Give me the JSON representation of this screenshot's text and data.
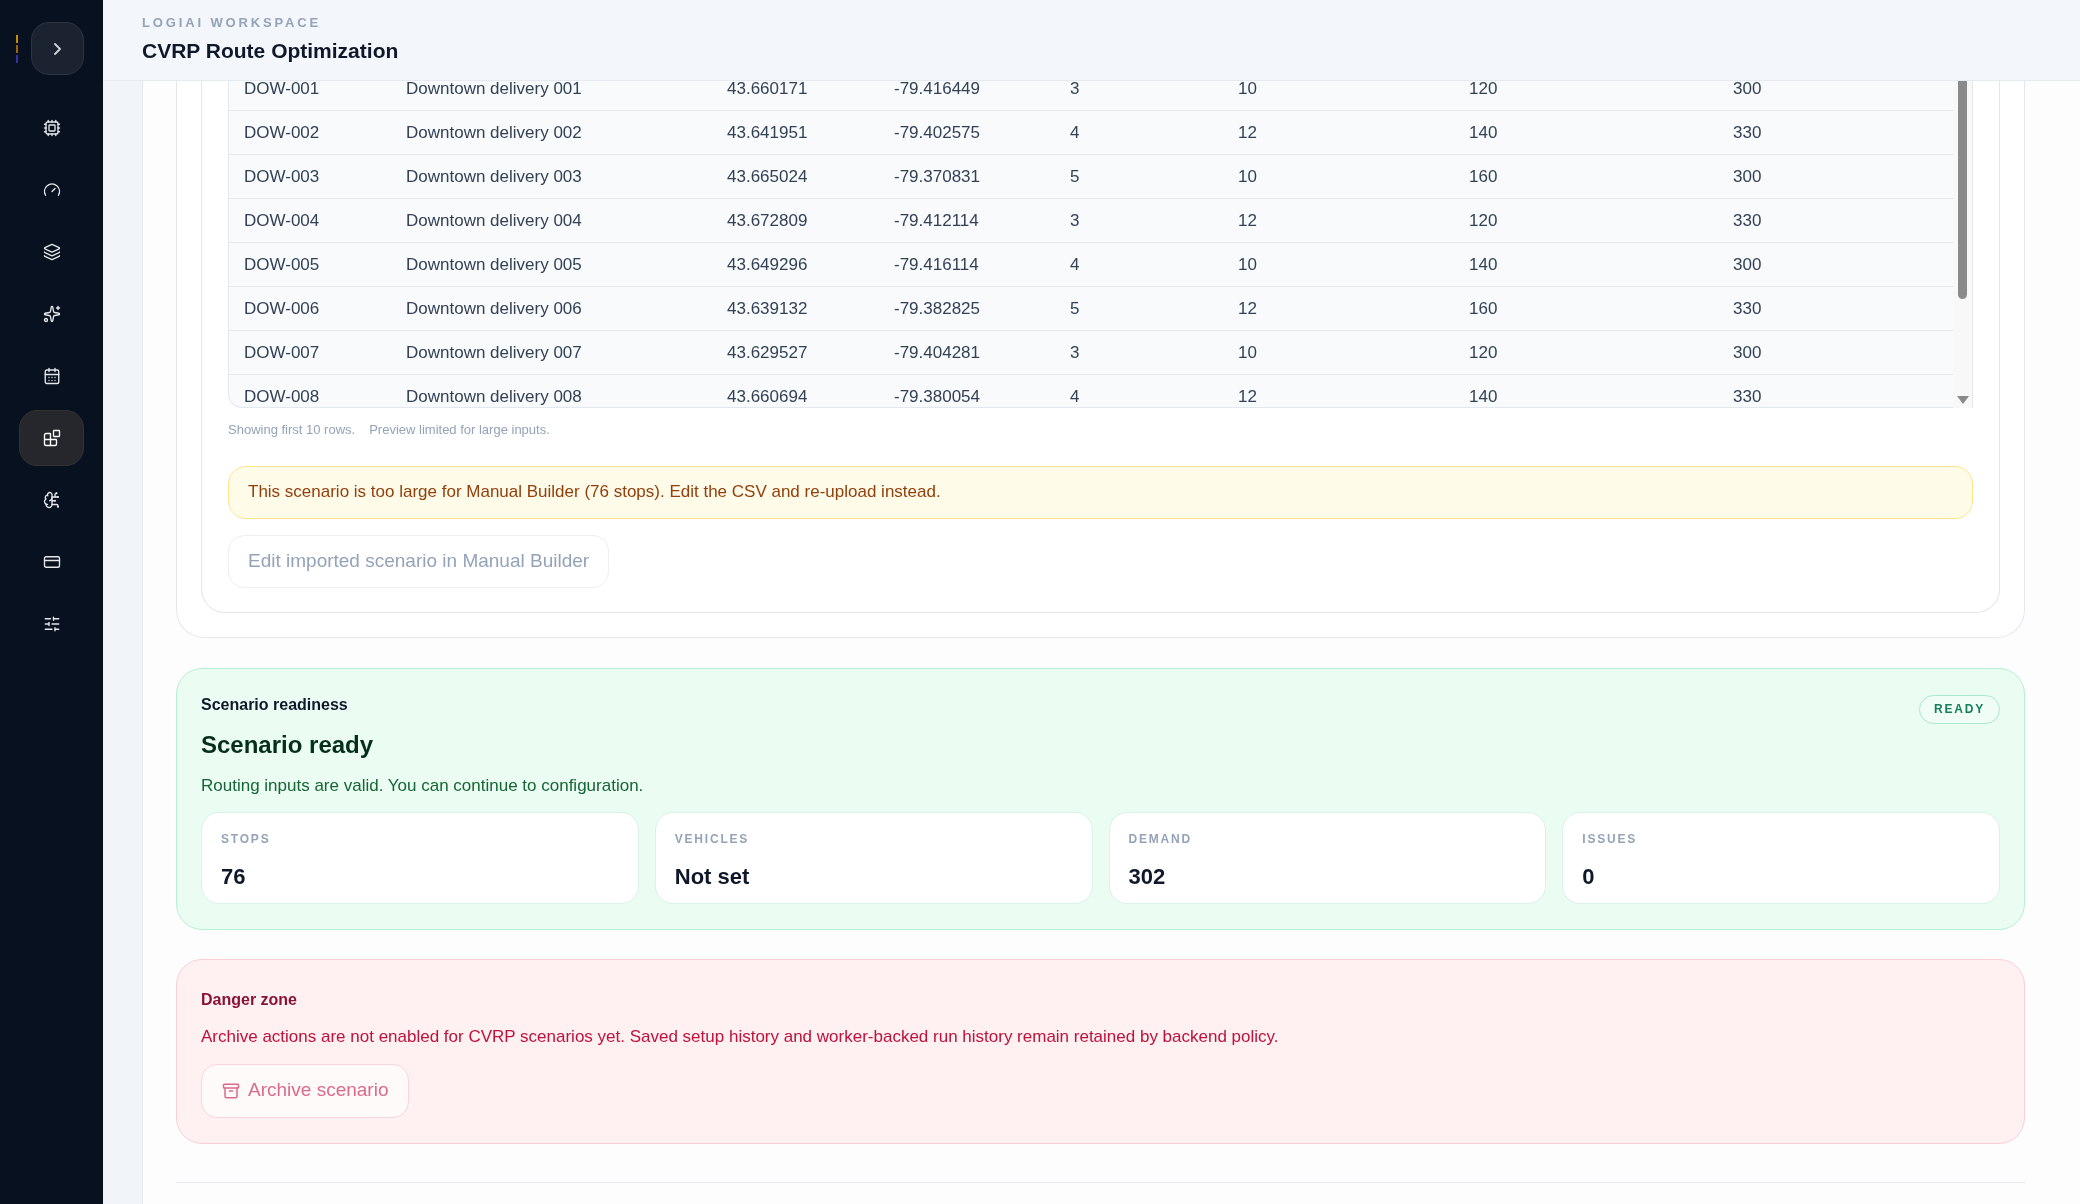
{
  "sidebar": {
    "items": [
      {
        "selected": false
      },
      {
        "selected": false
      },
      {
        "selected": false
      },
      {
        "selected": false
      },
      {
        "selected": false
      },
      {
        "selected": true
      },
      {
        "selected": false
      },
      {
        "selected": false
      },
      {
        "selected": false
      }
    ]
  },
  "header": {
    "workspace": "LOGIAI WORKSPACE",
    "title": "CVRP Route Optimization"
  },
  "preview": {
    "rows": [
      [
        "DOW-001",
        "Downtown delivery 001",
        "43.660171",
        "-79.416449",
        "3",
        "10",
        "120",
        "300"
      ],
      [
        "DOW-002",
        "Downtown delivery 002",
        "43.641951",
        "-79.402575",
        "4",
        "12",
        "140",
        "330"
      ],
      [
        "DOW-003",
        "Downtown delivery 003",
        "43.665024",
        "-79.370831",
        "5",
        "10",
        "160",
        "300"
      ],
      [
        "DOW-004",
        "Downtown delivery 004",
        "43.672809",
        "-79.412114",
        "3",
        "12",
        "120",
        "330"
      ],
      [
        "DOW-005",
        "Downtown delivery 005",
        "43.649296",
        "-79.416114",
        "4",
        "10",
        "140",
        "300"
      ],
      [
        "DOW-006",
        "Downtown delivery 006",
        "43.639132",
        "-79.382825",
        "5",
        "12",
        "160",
        "330"
      ],
      [
        "DOW-007",
        "Downtown delivery 007",
        "43.629527",
        "-79.404281",
        "3",
        "10",
        "120",
        "300"
      ],
      [
        "DOW-008",
        "Downtown delivery 008",
        "43.660694",
        "-79.380054",
        "4",
        "12",
        "140",
        "330"
      ]
    ],
    "captions": [
      "Showing first 10 rows.",
      "Preview limited for large inputs."
    ],
    "warning": "This scenario is too large for Manual Builder (76 stops). Edit the CSV and re-upload instead.",
    "edit_button": {
      "label": "Edit imported scenario in Manual Builder",
      "disabled": true
    }
  },
  "readiness": {
    "label": "Scenario readiness",
    "title": "Scenario ready",
    "message": "Routing inputs are valid. You can continue to configuration.",
    "badge": "READY",
    "stats": [
      {
        "label": "STOPS",
        "value": "76"
      },
      {
        "label": "VEHICLES",
        "value": "Not set"
      },
      {
        "label": "DEMAND",
        "value": "302"
      },
      {
        "label": "ISSUES",
        "value": "0"
      }
    ]
  },
  "danger": {
    "title": "Danger zone",
    "message": "Archive actions are not enabled for CVRP scenarios yet. Saved setup history and worker-backed run history remain retained by backend policy.",
    "button": {
      "label": "Archive scenario",
      "disabled": true
    }
  }
}
